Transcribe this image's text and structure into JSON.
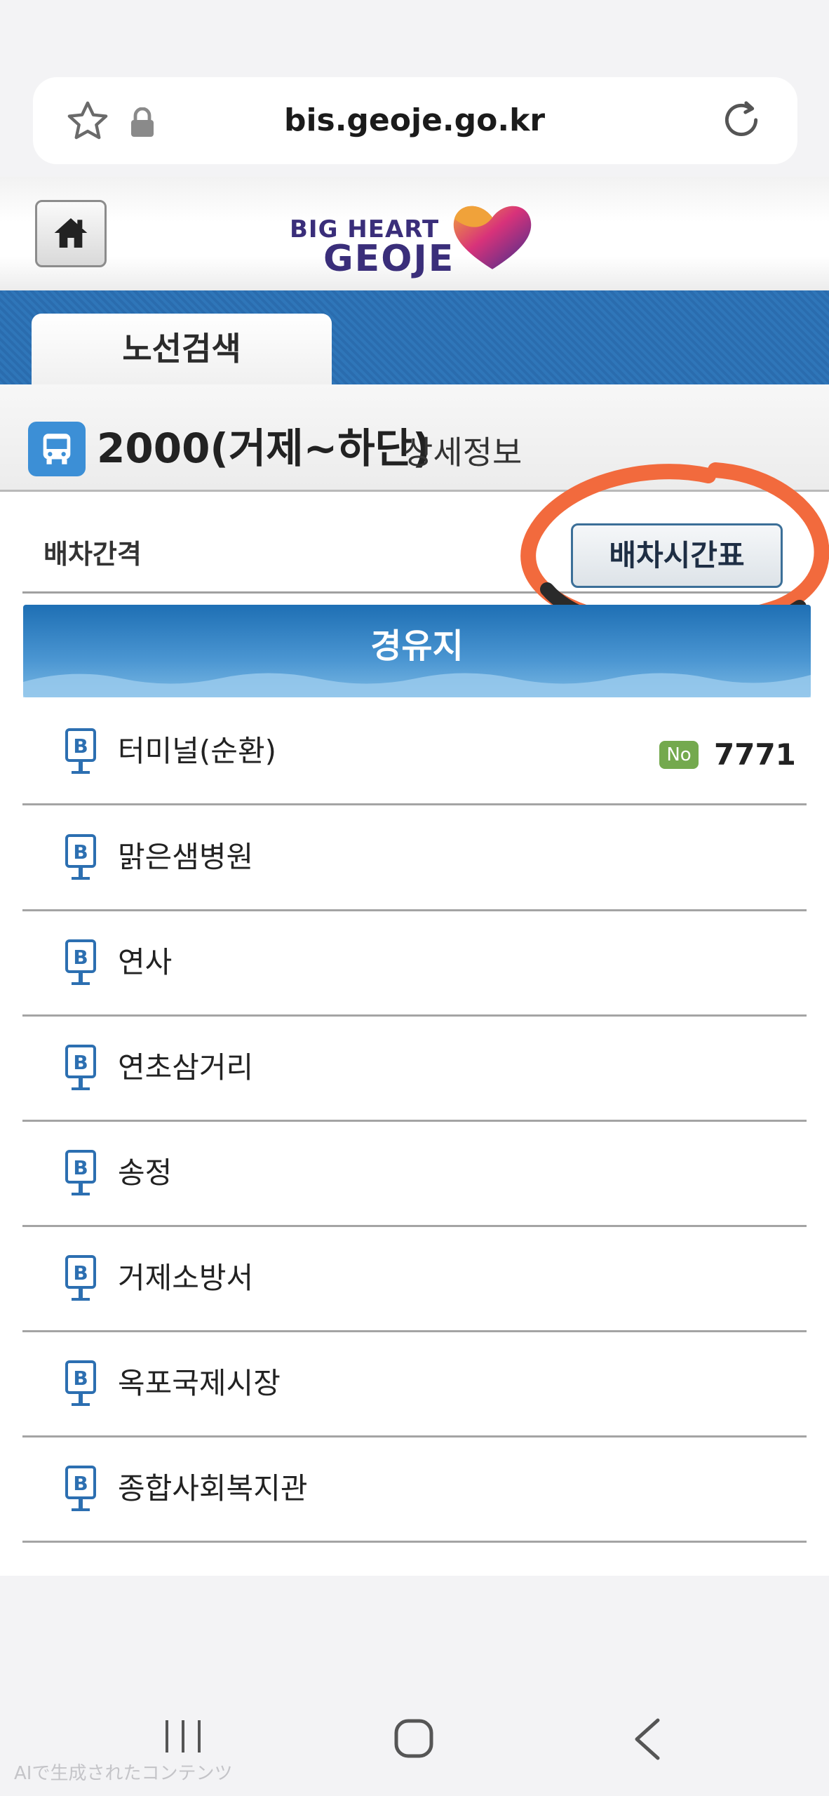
{
  "browser": {
    "url": "bis.geoje.go.kr",
    "icons": [
      "star-icon",
      "lock-icon",
      "reload-icon"
    ]
  },
  "header": {
    "logo_line1": "BIG HEART",
    "logo_line2": "GEOJE",
    "home_icon": "home-icon"
  },
  "tabs": [
    {
      "label": "노선검색"
    }
  ],
  "route": {
    "name": "2000(거제~하단)",
    "suffix": "상세정보"
  },
  "interval": {
    "label": "배차간격",
    "timetable_button": "배차시간표"
  },
  "stops_header": "경유지",
  "stops": [
    {
      "name": "터미널(순환)",
      "badge": "No",
      "bus_number": "7771"
    },
    {
      "name": "맑은샘병원"
    },
    {
      "name": "연사"
    },
    {
      "name": "연초삼거리"
    },
    {
      "name": "송정"
    },
    {
      "name": "거제소방서"
    },
    {
      "name": "옥포국제시장"
    },
    {
      "name": "종합사회복지관"
    }
  ],
  "watermark": "AIで生成されたコンテンツ",
  "colors": {
    "accent_blue": "#2f76b9",
    "circle_orange": "#f26a3d",
    "badge_green": "#74a94e"
  }
}
